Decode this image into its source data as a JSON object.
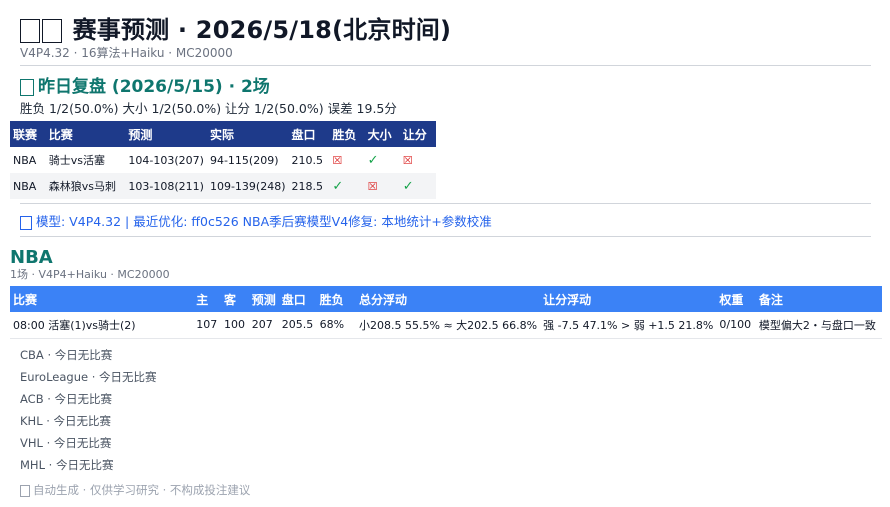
{
  "header": {
    "title": "赛事预测 · 2026/5/18(北京时间)",
    "subtitle": "V4P4.32 · 16算法+Haiku · MC20000"
  },
  "review": {
    "title": "昨日复盘 (2026/5/15) · 2场",
    "stats": "胜负 1/2(50.0%)  大小 1/2(50.0%)  让分 1/2(50.0%)  误差 19.5分",
    "columns": [
      "联赛",
      "比赛",
      "预测",
      "实际",
      "盘口",
      "胜负",
      "大小",
      "让分"
    ],
    "rows": [
      {
        "league": "NBA",
        "match": "骑士vs活塞",
        "pred": "104-103(207)",
        "actual": "94-115(209)",
        "line": "210.5",
        "wl": "bad",
        "ou": "ok",
        "spread": "bad"
      },
      {
        "league": "NBA",
        "match": "森林狼vs马刺",
        "pred": "103-108(211)",
        "actual": "109-139(248)",
        "line": "218.5",
        "wl": "ok",
        "ou": "bad",
        "spread": "ok"
      }
    ]
  },
  "model_line": "模型: V4P4.32 | 最近优化: ff0c526 NBA季后赛模型V4修复: 本地统计+参数校准",
  "league": {
    "title": "NBA",
    "subtitle": "1场 · V4P4+Haiku · MC20000",
    "columns": [
      "比赛",
      "主",
      "客",
      "预测",
      "盘口",
      "胜负",
      "总分浮动",
      "让分浮动",
      "权重",
      "备注"
    ],
    "games": [
      {
        "match": "08:00 活塞(1)vs骑士(2)",
        "home": "107",
        "away": "100",
        "pred": "207",
        "line": "205.5",
        "win": "68%",
        "total_float": "小208.5 55.5% ≈ 大202.5 66.8%",
        "spread_float": "强 -7.5 47.1% > 弱 +1.5 21.8%",
        "weight": "0/100",
        "note": "模型偏大2・与盘口一致"
      }
    ]
  },
  "empty_leagues": [
    "CBA · 今日无比赛",
    "EuroLeague · 今日无比赛",
    "ACB · 今日无比赛",
    "KHL · 今日无比赛",
    "VHL · 今日无比赛",
    "MHL · 今日无比赛"
  ],
  "footer": "自动生成 · 仅供学习研究 · 不构成投注建议",
  "icons": {
    "ok": "✓",
    "bad": "☒"
  },
  "colors": {
    "teal": "#0f766e",
    "navy_header": "#1e3a8a",
    "blue_header": "#3b82f6",
    "link_blue": "#2563eb",
    "green": "#16a34a",
    "red": "#dc2626"
  }
}
